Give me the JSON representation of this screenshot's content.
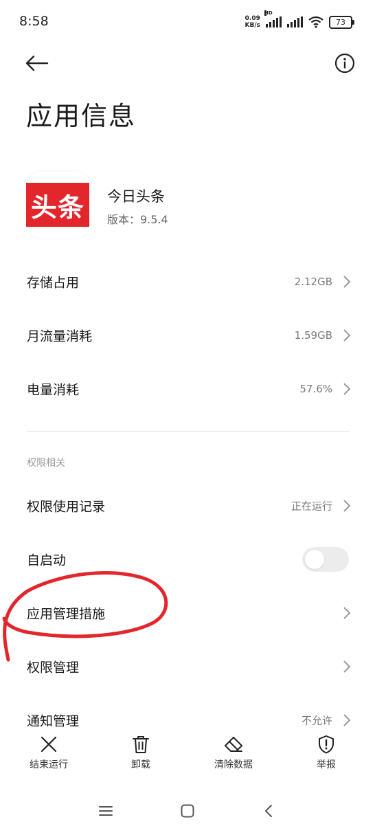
{
  "status_bar": {
    "time": "8:58",
    "net_speed_value": "0.09",
    "net_speed_unit": "KB/s",
    "hd_label": "HD",
    "battery": "73"
  },
  "header": {
    "title": "应用信息",
    "back_icon": "arrow-left-icon",
    "info_icon": "info-circle-icon"
  },
  "app": {
    "icon_text": "头条",
    "name": "今日头条",
    "version": "版本：9.5.4",
    "icon_color": "#e3262c"
  },
  "usage_rows": [
    {
      "label": "存储占用",
      "value": "2.12GB"
    },
    {
      "label": "月流量消耗",
      "value": "1.59GB"
    },
    {
      "label": "电量消耗",
      "value": "57.6%"
    }
  ],
  "permissions": {
    "section_title": "权限相关",
    "record": {
      "label": "权限使用记录",
      "value": "正在运行"
    },
    "autostart": {
      "label": "自启动",
      "enabled": false
    },
    "app_management": {
      "label": "应用管理措施"
    },
    "permission_management": {
      "label": "权限管理"
    },
    "notification_management": {
      "label": "通知管理",
      "value": "不允许"
    }
  },
  "actions": [
    {
      "label": "结束运行",
      "icon": "close-icon"
    },
    {
      "label": "卸载",
      "icon": "trash-icon"
    },
    {
      "label": "清除数据",
      "icon": "eraser-icon"
    },
    {
      "label": "举报",
      "icon": "shield-alert-icon"
    }
  ],
  "nav": {
    "menu_icon": "menu-icon",
    "home_icon": "home-square-icon",
    "back_icon": "back-triangle-icon"
  },
  "colors": {
    "annotation": "#e3262c",
    "toggle_off": "#ececec"
  }
}
